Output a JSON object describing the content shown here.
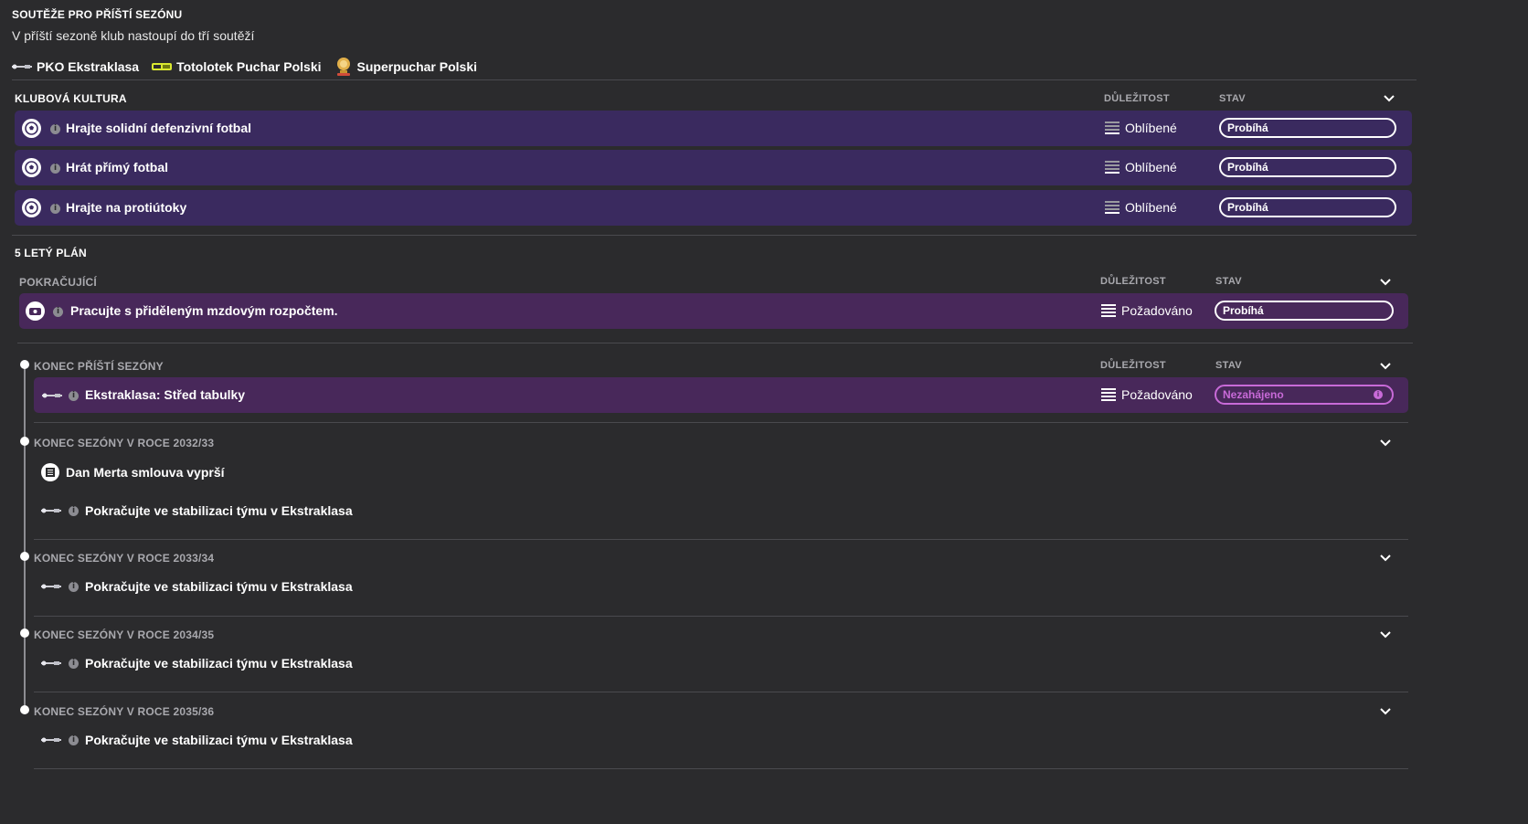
{
  "competitions": {
    "title": "SOUTĚŽE PRO PŘÍŠTÍ SEZÓNU",
    "subtitle": "V příští sezoně klub nastoupí do tří soutěží",
    "items": [
      {
        "name": "PKO Ekstraklasa",
        "icon": "ekstraklasa-logo-icon"
      },
      {
        "name": "Totolotek Puchar Polski",
        "icon": "puchar-polski-logo-icon"
      },
      {
        "name": "Superpuchar Polski",
        "icon": "superpuchar-trophy-icon"
      }
    ]
  },
  "culture": {
    "title": "KLUBOVÁ KULTURA",
    "col_importance": "DŮLEŽITOST",
    "col_status": "STAV",
    "rows": [
      {
        "label": "Hrajte solidní defenzivní fotbal",
        "importance": "Oblíbené",
        "status": "Probíhá"
      },
      {
        "label": "Hrát přímý fotbal",
        "importance": "Oblíbené",
        "status": "Probíhá"
      },
      {
        "label": "Hrajte na protiútoky",
        "importance": "Oblíbené",
        "status": "Probíhá"
      }
    ]
  },
  "plan": {
    "title": "5 LETÝ PLÁN",
    "ongoing": {
      "title": "POKRAČUJÍCÍ",
      "col_importance": "DŮLEŽITOST",
      "col_status": "STAV",
      "row": {
        "label": "Pracujte s přiděleným mzdovým rozpočtem.",
        "importance": "Požadováno",
        "status": "Probíhá"
      }
    },
    "next_season": {
      "title": "KONEC PŘÍŠTÍ SEZÓNY",
      "col_importance": "DŮLEŽITOST",
      "col_status": "STAV",
      "row": {
        "label": "Ekstraklasa: Střed tabulky",
        "importance": "Požadováno",
        "status": "Nezahájeno"
      }
    },
    "s2033": {
      "title": "KONEC SEZÓNY V ROCE 2032/33",
      "items": [
        "Dan Merta smlouva vyprší",
        "Pokračujte ve stabilizaci týmu v Ekstraklasa"
      ]
    },
    "s2034": {
      "title": "KONEC SEZÓNY V ROCE 2033/34",
      "items": [
        "Pokračujte ve stabilizaci týmu v Ekstraklasa"
      ]
    },
    "s2035": {
      "title": "KONEC SEZÓNY V ROCE 2034/35",
      "items": [
        "Pokračujte ve stabilizaci týmu v Ekstraklasa"
      ]
    },
    "s2036": {
      "title": "KONEC SEZÓNY V ROCE 2035/36",
      "items": [
        "Pokračujte ve stabilizaci týmu v Ekstraklasa"
      ]
    }
  },
  "colors": {
    "background": "#2b2b2d",
    "culture_row": "#3a2a5f",
    "plan_row": "#48285a",
    "pending_status": "#c86ad8"
  }
}
